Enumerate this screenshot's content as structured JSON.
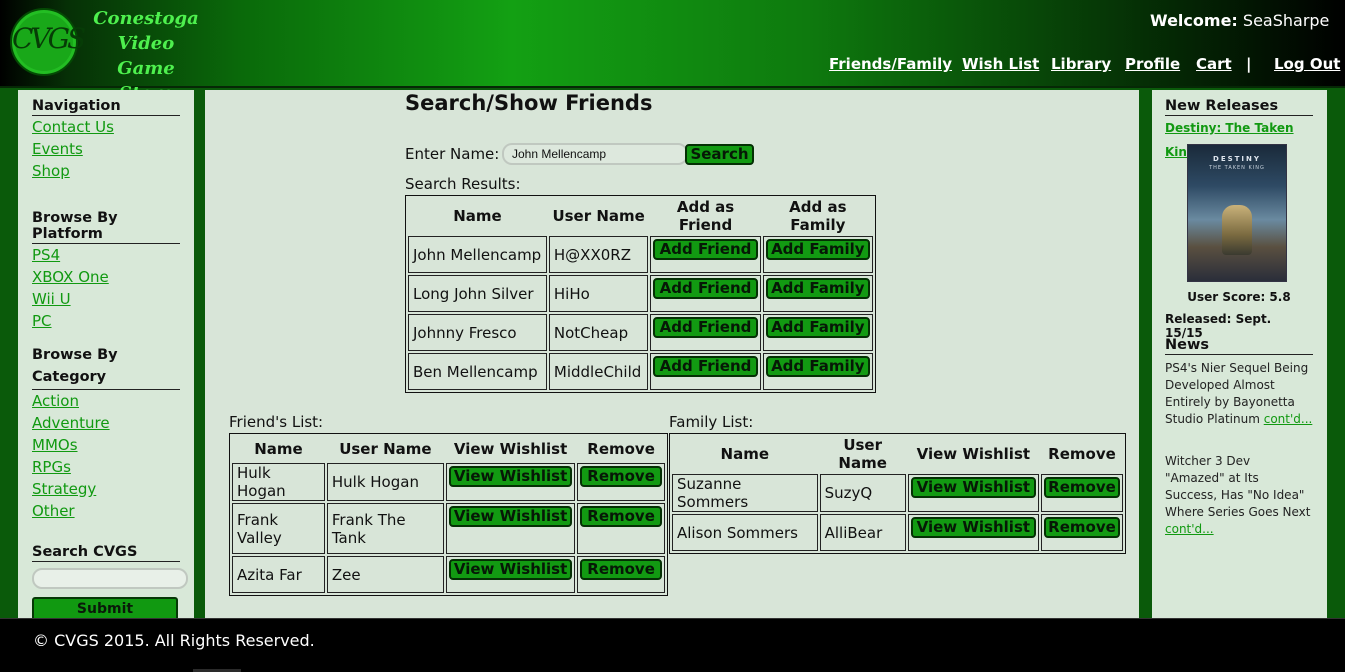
{
  "header": {
    "logo_mark": "CVGS",
    "logo_lines": [
      "Conestoga",
      "Video Game",
      "Store"
    ],
    "welcome_label": "Welcome:",
    "username": "SeaSharpe",
    "nav": [
      "Friends/Family",
      "Wish List",
      "Library",
      "Profile",
      "Cart",
      "Log Out"
    ],
    "separator": "|"
  },
  "left": {
    "navigation": {
      "heading": "Navigation",
      "links": [
        "Contact Us",
        "Events",
        "Shop"
      ]
    },
    "platform": {
      "heading": "Browse By Platform",
      "links": [
        "PS4",
        "XBOX One",
        "Wii U",
        "PC"
      ]
    },
    "category": {
      "heading": "Browse By Category",
      "links": [
        "Action",
        "Adventure",
        "MMOs",
        "RPGs",
        "Strategy",
        "Other"
      ]
    },
    "search": {
      "heading": "Search CVGS",
      "value": "",
      "submit": "Submit"
    }
  },
  "main": {
    "title": "Search/Show Friends",
    "enter_name_label": "Enter Name:",
    "search_value": "John Mellencamp",
    "search_button": "Search",
    "results_label": "Search Results:",
    "results": {
      "headers": [
        "Name",
        "User Name",
        "Add as Friend",
        "Add as Family"
      ],
      "rows": [
        {
          "name": "John Mellencamp",
          "user": "H@XX0RZ"
        },
        {
          "name": "Long John Silver",
          "user": "HiHo"
        },
        {
          "name": "Johnny Fresco",
          "user": "NotCheap"
        },
        {
          "name": "Ben Mellencamp",
          "user": "MiddleChild"
        }
      ],
      "add_friend": "Add Friend",
      "add_family": "Add Family"
    },
    "friends": {
      "label": "Friend's List:",
      "headers": [
        "Name",
        "User Name",
        "View Wishlist",
        "Remove"
      ],
      "rows": [
        {
          "name": "Hulk Hogan",
          "user": "Hulk Hogan"
        },
        {
          "name": "Frank Valley",
          "user": "Frank The Tank"
        },
        {
          "name": "Azita Far",
          "user": "Zee"
        }
      ]
    },
    "family": {
      "label": "Family List:",
      "headers": [
        "Name",
        "User Name",
        "View Wishlist",
        "Remove"
      ],
      "rows": [
        {
          "name": "Suzanne Sommers",
          "user": "SuzyQ"
        },
        {
          "name": "Alison Sommers",
          "user": "AlliBear"
        }
      ]
    },
    "view_wishlist": "View Wishlist",
    "remove": "Remove"
  },
  "right": {
    "new_releases": {
      "heading": "New Releases",
      "game_title": "Destiny: The Taken King",
      "cover_title": "DESTINY",
      "cover_subtitle": "THE TAKEN KING",
      "user_score": "User Score: 5.8",
      "released": "Released: Sept. 15/15"
    },
    "news": {
      "heading": "News",
      "items": [
        {
          "text": "PS4's Nier Sequel Being Developed Almost Entirely by Bayonetta Studio Platinum ",
          "link": "cont'd..."
        },
        {
          "text": "Witcher 3 Dev \"Amazed\" at Its Success, Has \"No Idea\" Where Series Goes Next ",
          "link": "cont'd..."
        }
      ]
    }
  },
  "footer": {
    "text": "© CVGS 2015. All Rights Reserved."
  },
  "colors": {
    "accent": "#119911",
    "header_green": "#13a013",
    "panel": "#d8e5d8",
    "footer": "#000000"
  }
}
